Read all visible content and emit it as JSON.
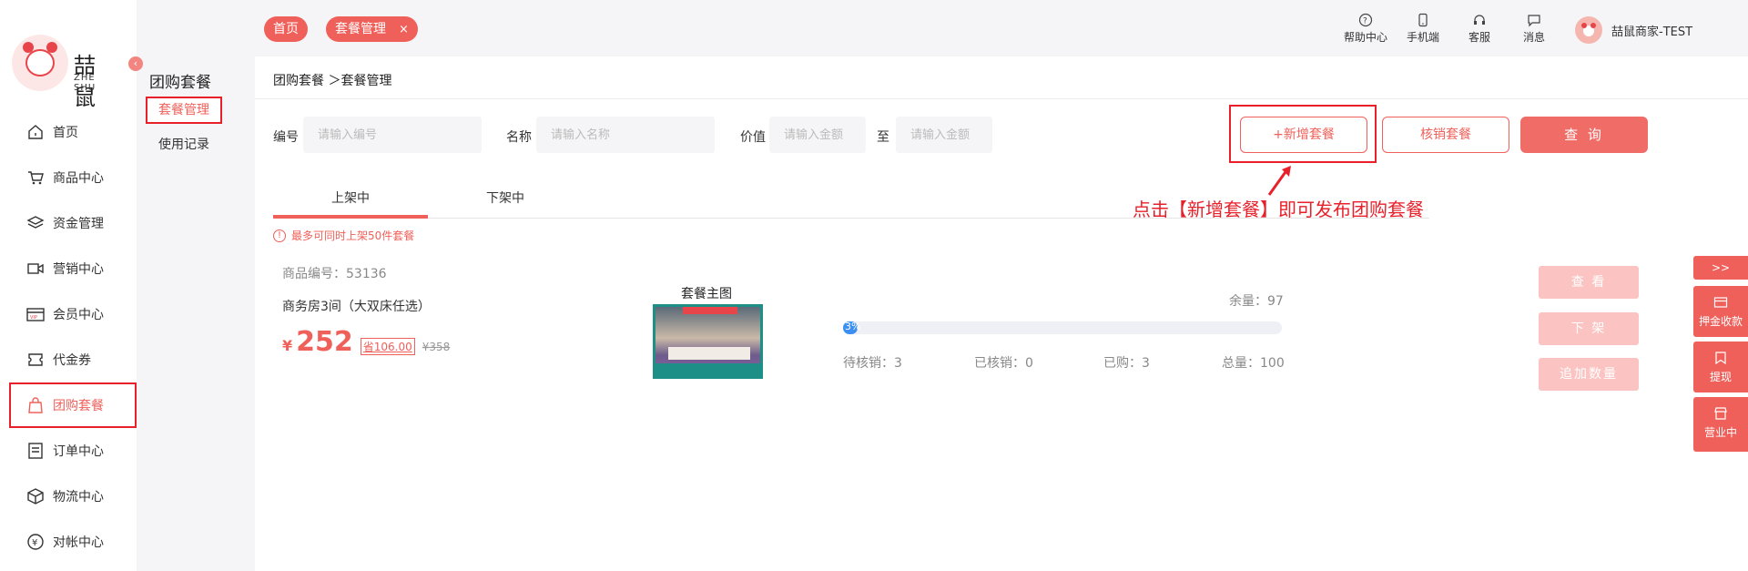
{
  "brand": {
    "name_cn": "喆鼠",
    "name_en": "ZHE SHU"
  },
  "sidebar": {
    "items": [
      {
        "label": "首页",
        "icon": "home-icon"
      },
      {
        "label": "商品中心",
        "icon": "cart-icon"
      },
      {
        "label": "资金管理",
        "icon": "layers-icon"
      },
      {
        "label": "营销中心",
        "icon": "video-icon"
      },
      {
        "label": "会员中心",
        "icon": "vip-card-icon"
      },
      {
        "label": "代金券",
        "icon": "coupon-icon"
      },
      {
        "label": "团购套餐",
        "icon": "bag-icon"
      },
      {
        "label": "订单中心",
        "icon": "order-icon"
      },
      {
        "label": "物流中心",
        "icon": "box-icon"
      },
      {
        "label": "对帐中心",
        "icon": "yen-icon"
      }
    ],
    "collapse_glyph": "‹"
  },
  "subbar": {
    "title": "团购套餐",
    "items": [
      {
        "label": "套餐管理"
      },
      {
        "label": "使用记录"
      }
    ]
  },
  "topbar": {
    "tabs": [
      {
        "label": "首页"
      },
      {
        "label": "套餐管理",
        "close": "×"
      }
    ],
    "tools": [
      {
        "label": "帮助中心",
        "icon": "help-icon"
      },
      {
        "label": "手机端",
        "icon": "phone-icon"
      },
      {
        "label": "客服",
        "icon": "headset-icon"
      },
      {
        "label": "消息",
        "icon": "message-icon"
      }
    ],
    "user": {
      "name": "喆鼠商家-TEST"
    }
  },
  "breadcrumb": "团购套餐 ＞套餐管理",
  "filters": {
    "code_label": "编号",
    "code_placeholder": "请输入编号",
    "name_label": "名称",
    "name_placeholder": "请输入名称",
    "value_label": "价值",
    "min_placeholder": "请输入金额",
    "to_label": "至",
    "max_placeholder": "请输入金额"
  },
  "buttons": {
    "add": "+新增套餐",
    "verify": "核销套餐",
    "search": "查 询"
  },
  "annotation": "点击【新增套餐】即可发布团购套餐",
  "tabs": [
    {
      "label": "上架中"
    },
    {
      "label": "下架中"
    }
  ],
  "notice": {
    "icon": "!",
    "text": "最多可同时上架50件套餐"
  },
  "product": {
    "code": "商品编号：53136",
    "name": "商务房3间（大双床任选）",
    "currency": "¥",
    "price": "252",
    "save": "省106.00",
    "original": "¥358",
    "image_label": "套餐主图",
    "remaining": "余量：97",
    "progress_pct": 3,
    "progress_text": "3%",
    "pending": "待核销：3",
    "verified": "已核销：0",
    "bought": "已购：3",
    "total": "总量：100"
  },
  "actions": {
    "view": "查 看",
    "offshelf": "下 架",
    "add_qty": "追加数量"
  },
  "float_panel": {
    "toggle": ">>",
    "items": [
      {
        "label": "押金收款",
        "icon": "card-icon"
      },
      {
        "label": "提现",
        "icon": "bookmark-icon"
      },
      {
        "label": "营业中",
        "icon": "store-icon"
      }
    ]
  },
  "colors": {
    "accent": "#f0605a",
    "highlight": "#e8202a",
    "progress": "#3c8ff0"
  }
}
